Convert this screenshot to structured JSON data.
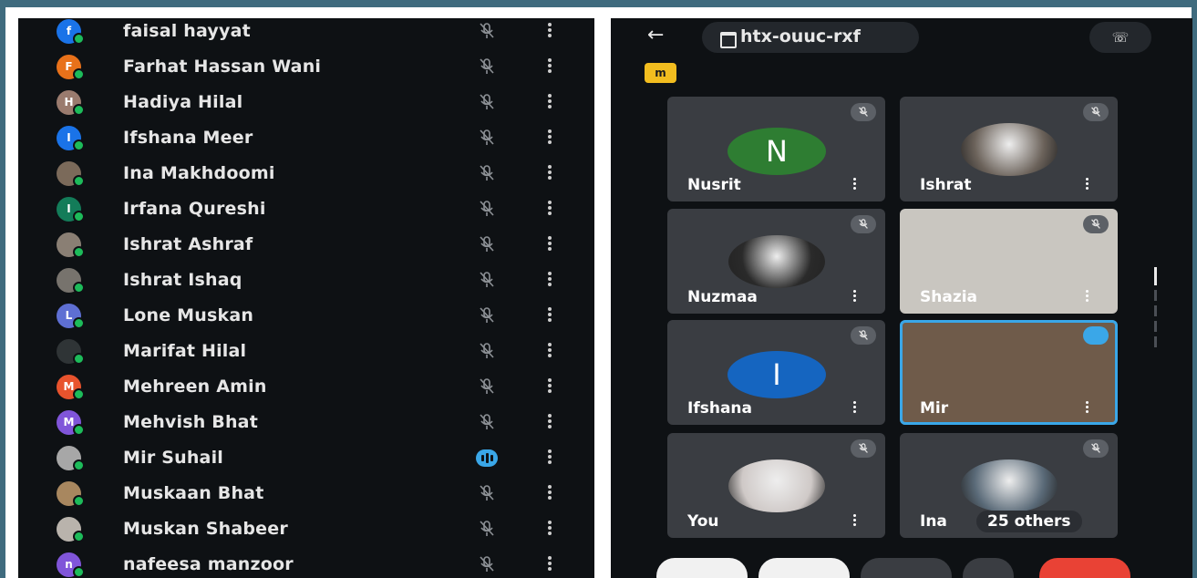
{
  "participants": [
    {
      "initial": "f",
      "name": "faisal hayyat",
      "color": "#1a73e8",
      "speaking": false
    },
    {
      "initial": "F",
      "name": "Farhat Hassan Wani",
      "color": "#e8711a",
      "speaking": false
    },
    {
      "initial": "H",
      "name": "Hadiya Hilal",
      "color": "#9a7b6e",
      "speaking": false
    },
    {
      "initial": "I",
      "name": "Ifshana Meer",
      "color": "#1a73e8",
      "speaking": false
    },
    {
      "initial": "",
      "name": "Ina Makhdoomi",
      "color": "#7b6a5a",
      "speaking": false
    },
    {
      "initial": "I",
      "name": "Irfana Qureshi",
      "color": "#137c59",
      "speaking": false
    },
    {
      "initial": "",
      "name": "Ishrat Ashraf",
      "color": "#8a7f74",
      "speaking": false
    },
    {
      "initial": "",
      "name": "Ishrat Ishaq",
      "color": "#77736d",
      "speaking": false
    },
    {
      "initial": "L",
      "name": "Lone Muskan",
      "color": "#5e6fd3",
      "speaking": false
    },
    {
      "initial": "",
      "name": "Marifat Hilal",
      "color": "#2f3436",
      "speaking": false
    },
    {
      "initial": "M",
      "name": "Mehreen Amin",
      "color": "#e8532d",
      "speaking": false
    },
    {
      "initial": "M",
      "name": "Mehvish Bhat",
      "color": "#8055d9",
      "speaking": false
    },
    {
      "initial": "",
      "name": "Mir Suhail",
      "color": "#a7a7a7",
      "speaking": true
    },
    {
      "initial": "",
      "name": "Muskaan Bhat",
      "color": "#a8875f",
      "speaking": false
    },
    {
      "initial": "",
      "name": "Muskan Shabeer",
      "color": "#b9b3ac",
      "speaking": false
    },
    {
      "initial": "n",
      "name": "nafeesa manzoor",
      "color": "#8055d9",
      "speaking": false
    }
  ],
  "meeting": {
    "back_icon": "arrow-left-icon",
    "code": "htx-ouuc-rxf",
    "call_icon": "phone-switch-icon",
    "caption_badge": "m"
  },
  "tiles": [
    {
      "name": "Nusrit",
      "type": "letter",
      "letter": "N",
      "color": "#2e7d32",
      "speaking": false
    },
    {
      "name": "Ishrat",
      "type": "photo",
      "color": "#6b625a",
      "speaking": false
    },
    {
      "name": "Nuzmaa",
      "type": "photo",
      "color": "#2a2a2a",
      "speaking": false
    },
    {
      "name": "Shazia",
      "type": "video",
      "color": "#c9c6c0",
      "speaking": false
    },
    {
      "name": "Ifshana",
      "type": "letter",
      "letter": "I",
      "color": "#1565c0",
      "speaking": false
    },
    {
      "name": "Mir",
      "type": "video",
      "color": "#6f5b4a",
      "speaking": true
    },
    {
      "name": "You",
      "type": "photo",
      "color": "#cfc9c7",
      "speaking": false
    },
    {
      "name": "Ina",
      "type": "photo",
      "color": "#5a6a78",
      "speaking": false,
      "others": "25 others"
    }
  ],
  "colors": {
    "accent": "#3aa7e8",
    "end_call": "#e94235"
  }
}
